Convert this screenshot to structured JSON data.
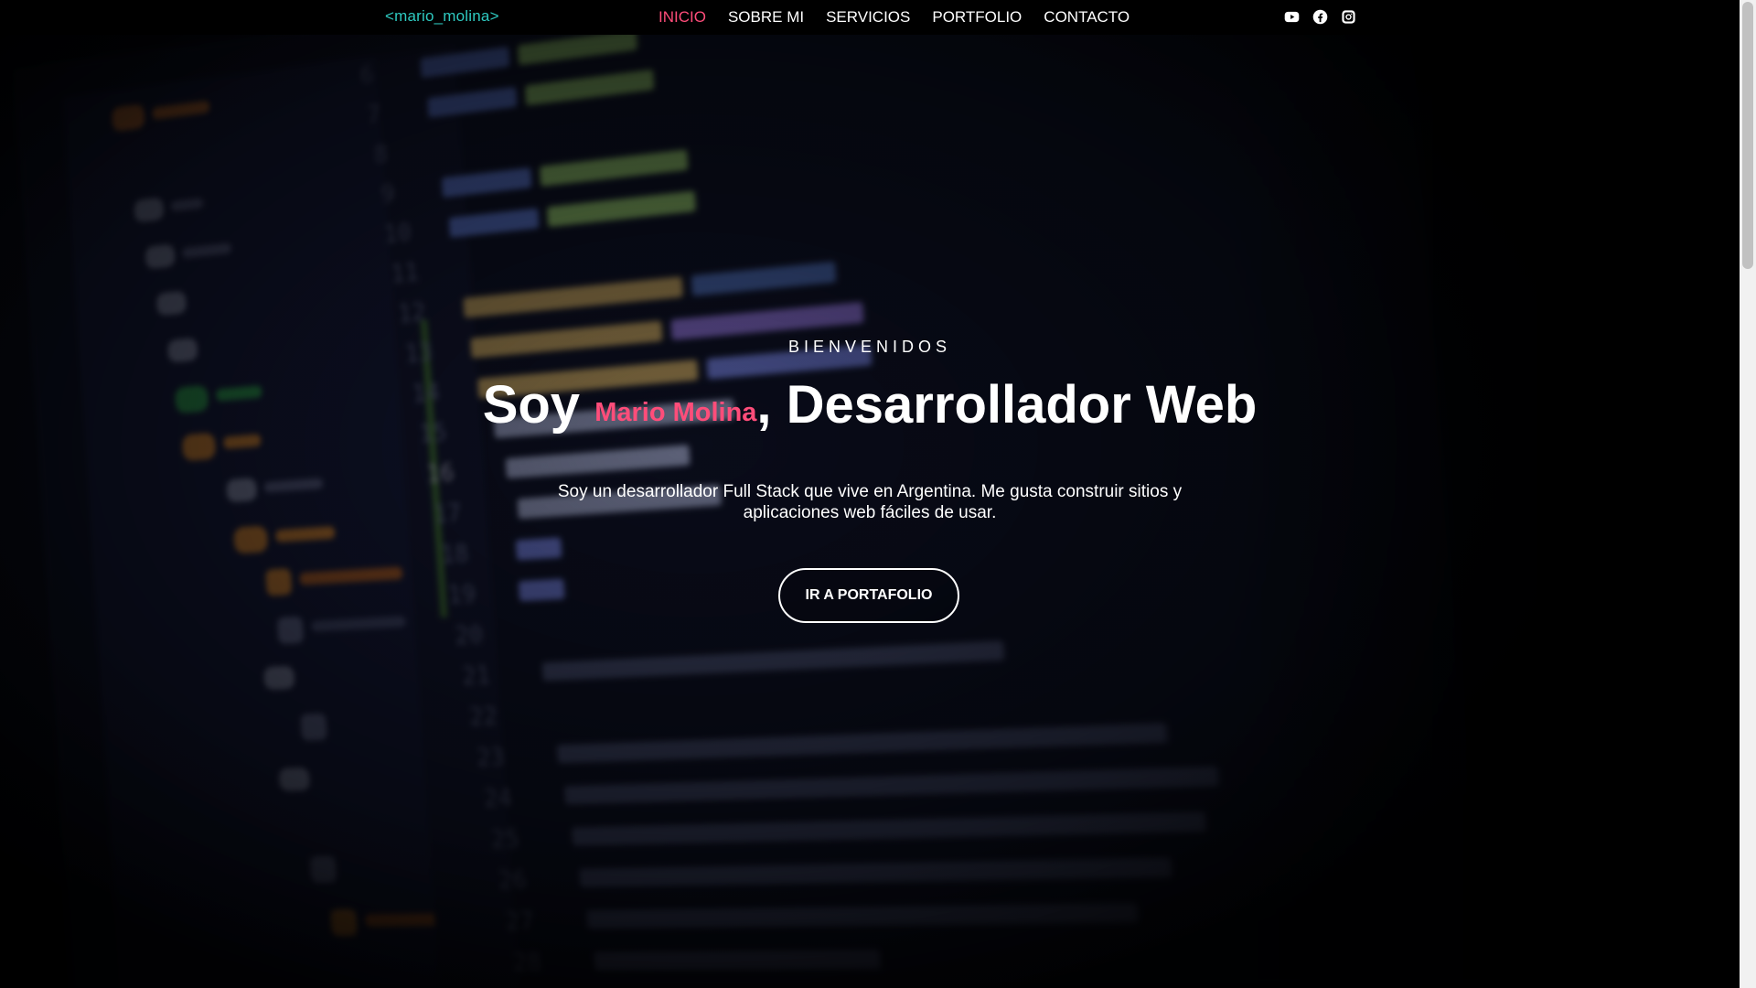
{
  "navbar": {
    "logo": "<mario_molina>",
    "links": [
      {
        "label": "INICIO",
        "active": true
      },
      {
        "label": "SOBRE MI",
        "active": false
      },
      {
        "label": "SERVICIOS",
        "active": false
      },
      {
        "label": "PORTFOLIO",
        "active": false
      },
      {
        "label": "CONTACTO",
        "active": false
      }
    ],
    "socials": [
      {
        "icon": "youtube-icon"
      },
      {
        "icon": "facebook-icon"
      },
      {
        "icon": "instagram-icon"
      }
    ]
  },
  "hero": {
    "eyebrow": "BIENVENIDOS",
    "headline_prefix": "Soy ",
    "headline_name": "Mario Molina",
    "headline_suffix": ", Desarrollador Web",
    "description": "Soy un desarrollador Full Stack que vive en Argentina. Me gusta construir sitios y aplicaciones web fáciles de usar.",
    "cta_label": "IR A PORTAFOLIO"
  },
  "colors": {
    "accent": "#ff4d7a",
    "logo": "#2ec9c0",
    "nav_bg": "#000000",
    "text": "#ffffff"
  }
}
